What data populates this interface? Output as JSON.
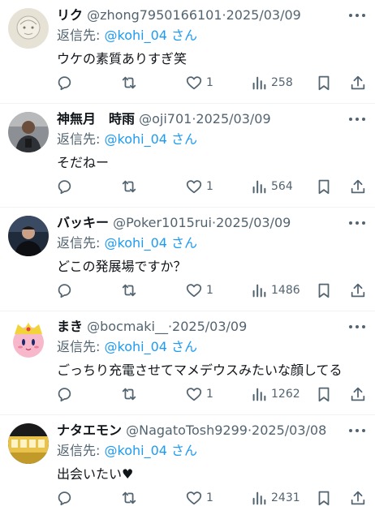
{
  "colors": {
    "text": "#0f1419",
    "muted": "#536471",
    "accent": "#1d9bf0",
    "divider": "#eff3f4"
  },
  "icons": [
    "reply-icon",
    "retweet-icon",
    "like-icon",
    "views-icon",
    "bookmark-icon",
    "share-icon",
    "more-icon"
  ],
  "reply_prefix": "返信先:",
  "reply_suffix": "さん",
  "tweets": [
    {
      "name": "リク",
      "handle": "@zhong7950166101",
      "dot": "·",
      "date": "2025/03/09",
      "reply_to": "@kohi_04",
      "text": "ウケの素質ありすぎ笑",
      "replies": "",
      "retweets": "",
      "likes": "1",
      "views": "258"
    },
    {
      "name": "神無月　時雨",
      "handle": "@oji701",
      "dot": "·",
      "date": "2025/03/09",
      "reply_to": "@kohi_04",
      "text": "そだねー",
      "replies": "",
      "retweets": "",
      "likes": "1",
      "views": "564"
    },
    {
      "name": "バッキー",
      "handle": "@Poker1015rui",
      "dot": "·",
      "date": "2025/03/09",
      "reply_to": "@kohi_04",
      "text": "どこの発展場ですか？",
      "replies": "",
      "retweets": "",
      "likes": "1",
      "views": "1486"
    },
    {
      "name": "まき",
      "handle": "@bocmaki__",
      "dot": "·",
      "date": "2025/03/09",
      "reply_to": "@kohi_04",
      "text": "ごっちり充電させてマメデウスみたいな顔してる",
      "replies": "",
      "retweets": "",
      "likes": "1",
      "views": "1262"
    },
    {
      "name": "ナタエモン",
      "handle": "@NagatoTosh9299",
      "dot": "·",
      "date": "2025/03/08",
      "reply_to": "@kohi_04",
      "text": "出会いたい",
      "text_emoji": "♥",
      "replies": "",
      "retweets": "",
      "likes": "1",
      "views": "2431"
    }
  ]
}
